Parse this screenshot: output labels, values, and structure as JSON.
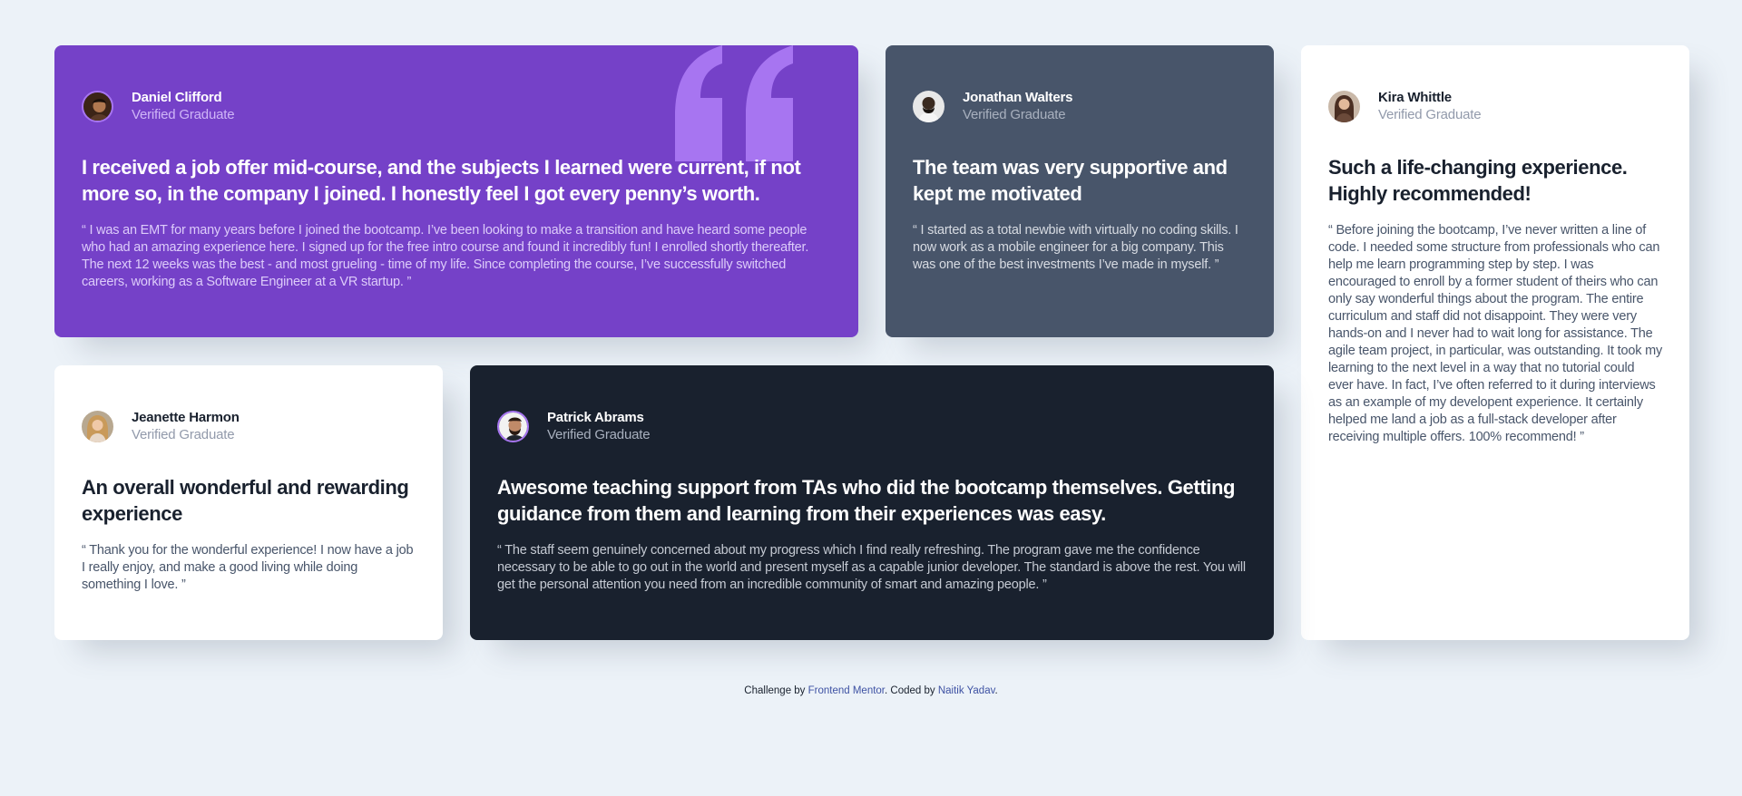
{
  "cards": [
    {
      "name": "Daniel Clifford",
      "role": "Verified Graduate",
      "headline": "I received a job offer mid-course, and the subjects I learned were current, if not more so, in the company I joined. I honestly feel I got every penny’s worth.",
      "body": "“ I was an EMT for many years before I joined the bootcamp. I’ve been looking to make a transition and have heard some people who had an amazing experience here. I signed up for the free intro course and found it incredibly fun! I enrolled shortly thereafter. The next 12 weeks was the best - and most grueling - time of my life. Since completing the course, I’ve successfully switched careers, working as a Software Engineer at a VR startup. ”",
      "bg_color": "#7541c8"
    },
    {
      "name": "Jonathan Walters",
      "role": "Verified Graduate",
      "headline": "The team was very supportive and kept me motivated",
      "body": "“ I started as a total newbie with virtually no coding skills. I now work as a mobile engineer for a big company. This was one of the best investments I’ve made in myself. ”",
      "bg_color": "#48556a"
    },
    {
      "name": "Kira Whittle",
      "role": "Verified Graduate",
      "headline": "Such a life-changing experience. Highly recommended!",
      "body": "“ Before joining the bootcamp, I’ve never written a line of code. I needed some structure from professionals who can help me learn programming step by step. I was encouraged to enroll by a former student of theirs who can only say wonderful things about the program. The entire curriculum and staff did not disappoint. They were very hands-on and I never had to wait long for assistance. The agile team project, in particular, was outstanding. It took my learning to the next level in a way that no tutorial could ever have. In fact, I’ve often referred to it during interviews as an example of my developent experience. It certainly helped me land a job as a full-stack developer after receiving multiple offers. 100% recommend! ”",
      "bg_color": "#ffffff"
    },
    {
      "name": "Jeanette Harmon",
      "role": "Verified Graduate",
      "headline": "An overall wonderful and rewarding experience",
      "body": "“ Thank you for the wonderful experience! I now have a job I really enjoy, and make a good living while doing something I love. ”",
      "bg_color": "#ffffff"
    },
    {
      "name": "Patrick Abrams",
      "role": "Verified Graduate",
      "headline": "Awesome teaching support from TAs who did the bootcamp themselves. Getting guidance from them and learning from their experiences was easy.",
      "body": "“ The staff seem genuinely concerned about my progress which I find really refreshing. The program gave me the confidence necessary to be able to go out in the world and present myself as a capable junior developer. The standard is above the rest. You will get the personal attention you need from an incredible community of smart and amazing people. ”",
      "bg_color": "#19212e"
    }
  ],
  "footer": {
    "prefix": "Challenge by ",
    "link1": "Frontend Mentor",
    "middle": ". Coded by ",
    "link2": "Naitik Yadav",
    "suffix": "."
  },
  "colors": {
    "page_bg": "#ecf2f8",
    "purple": "#7541c8",
    "gray_blue": "#48556a",
    "dark": "#19212e",
    "link": "#3e52a3"
  }
}
